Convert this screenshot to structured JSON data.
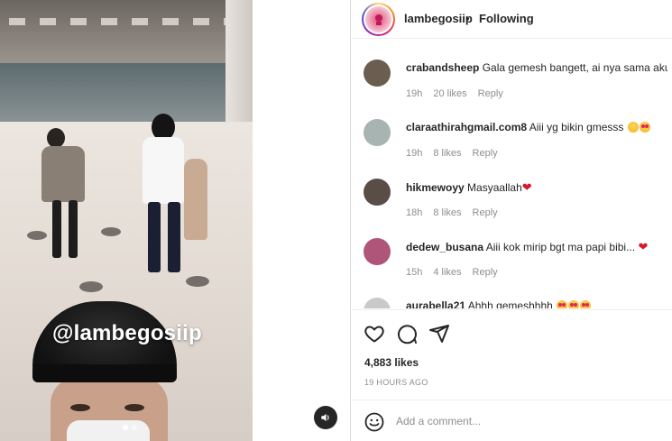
{
  "post": {
    "watermark": "@lambegosiip"
  },
  "header": {
    "username": "lambegosiip",
    "separator": "•",
    "follow_status": "Following"
  },
  "comments": [
    {
      "username": "crabandsheep",
      "text": "Gala gemesh bangett, ai nya sama aku",
      "time": "19h",
      "likes": "20 likes",
      "reply": "Reply",
      "avatar_color": "#6b5d4f"
    },
    {
      "username": "claraathirahgmail.com8",
      "text": "Aiii yg bikin gmesss",
      "time": "19h",
      "likes": "8 likes",
      "reply": "Reply",
      "avatar_color": "#a7b4b1"
    },
    {
      "username": "hikmewoyy",
      "text": "Masyaallah",
      "time": "18h",
      "likes": "8 likes",
      "reply": "Reply",
      "avatar_color": "#5a4d45"
    },
    {
      "username": "dedew_busana",
      "text": "Aiii kok mirip bgt ma papi bibi...",
      "time": "15h",
      "likes": "4 likes",
      "reply": "Reply",
      "avatar_color": "#b0557a"
    },
    {
      "username": "aurabella21",
      "text": "Ahhh gemeshhhh",
      "time": "",
      "likes": "",
      "reply": "",
      "avatar_color": "#c9c9c9"
    }
  ],
  "actions": {
    "likes": "4,883 likes",
    "time_ago": "19 HOURS AGO"
  },
  "add_comment": {
    "placeholder": "Add a comment..."
  },
  "colors": {
    "text": "#262626",
    "meta": "#8e8e8e",
    "border": "#dbdbdb",
    "heart": "#d6192b"
  }
}
